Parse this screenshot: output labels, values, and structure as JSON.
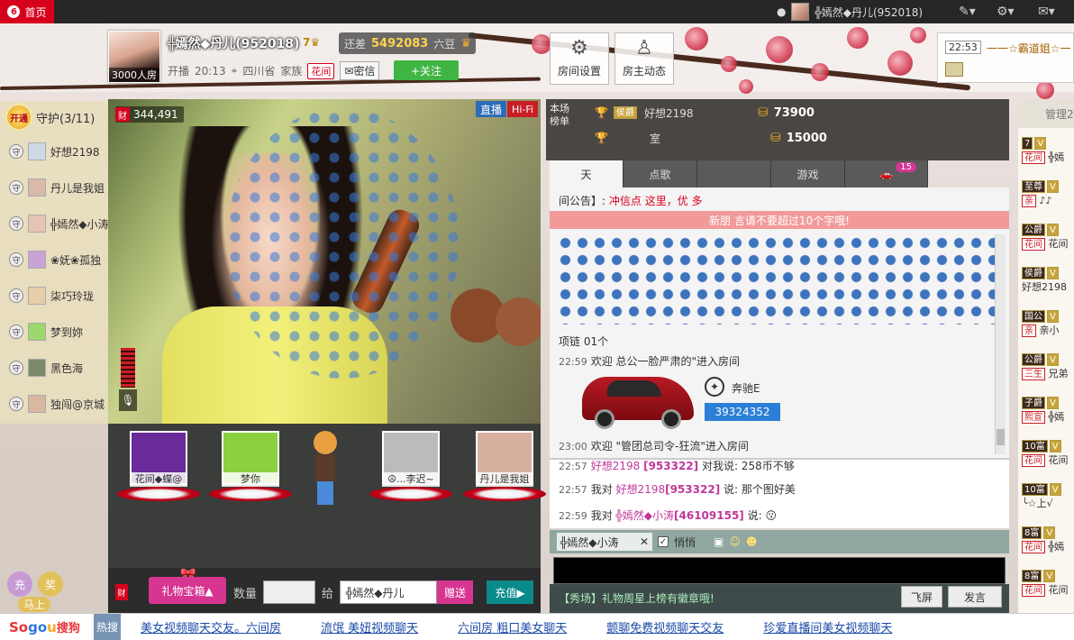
{
  "topbar": {
    "home_label": "首页",
    "user_name": "╬嫣然◆丹儿(952018)"
  },
  "host": {
    "room_count_label": "3000人房",
    "name": "╬嫣然◆丹儿(952018)",
    "level": "7",
    "gap_label": "还差",
    "gap_value": "5492083",
    "gap_unit": "六豆",
    "start_label": "开播",
    "start_time": "20:13",
    "location": "四川省",
    "family_label": "家族",
    "family_tag": "花间",
    "message_label": "密信",
    "follow_label": "+关注"
  },
  "header_buttons": [
    {
      "label": "房间设置",
      "icon": "gear-icon"
    },
    {
      "label": "房主动态",
      "icon": "person-icon"
    }
  ],
  "side_widget": {
    "time": "22:53",
    "text": "一一☆霸道姐☆一"
  },
  "guardians": {
    "open_label": "开通",
    "title": "守护(3/11)",
    "badge": "守",
    "items": [
      {
        "name": "好想2198",
        "color": "#cfd8e6"
      },
      {
        "name": "丹儿是我姐",
        "color": "#d9b9a8"
      },
      {
        "name": "╬嫣然◆小涛",
        "color": "#e8c4b4"
      },
      {
        "name": "❀妩❀孤独",
        "color": "#c9a3d6"
      },
      {
        "name": "柒巧玲珑",
        "color": "#e6cfa8"
      },
      {
        "name": "梦到妳",
        "color": "#9cd86a"
      },
      {
        "name": "黑色海",
        "color": "#7a8a6a"
      },
      {
        "name": "独闯@京城",
        "color": "#d8b8a0"
      }
    ]
  },
  "left_actions": {
    "recharge": "充",
    "reward": "奖",
    "shop": "马上"
  },
  "video": {
    "wealth": "344,491",
    "live_label": "直播",
    "hifi_label": "Hi-Fi"
  },
  "stage_seats": [
    {
      "label": "花间◆蝶@",
      "color": "#6a2a9a"
    },
    {
      "label": "梦你",
      "color": "#8ad040"
    },
    {
      "label": "",
      "color": "#3b3d3b"
    },
    {
      "label": "☮...李迟~",
      "color": "#bbbbbb"
    },
    {
      "label": "丹儿是我姐",
      "color": "#d8b0a0"
    }
  ],
  "gift_bar": {
    "wealth_badge": "财",
    "giftbox_label": "礼物宝箱▲",
    "qty_label": "数量",
    "to_label": "给",
    "recipient": "╬嫣然◆丹儿",
    "send_label": "赠送",
    "recharge_label": "充值▶"
  },
  "ranking": {
    "label": "本场榜单",
    "rows": [
      {
        "badge": "侯爵",
        "name": "好想2198",
        "value": "73900"
      },
      {
        "badge": "",
        "name": "室",
        "value": "15000"
      }
    ]
  },
  "chat_tabs": [
    {
      "label": "天",
      "active": true
    },
    {
      "label": "点歌",
      "active": false
    },
    {
      "label": "",
      "active": false
    },
    {
      "label": "游戏",
      "active": false
    },
    {
      "label": "15",
      "active": false,
      "icon": "car-icon"
    }
  ],
  "chat": {
    "announce_prefix": "间公告】:",
    "announce_text": "冲信点  这里，优  多",
    "red_notice": "新朋  言请不要超过10个字哦!",
    "item_line": "项链    01个",
    "lines": [
      {
        "time": "22:59",
        "text": "欢迎 总公一脸严肃的\"进入房间"
      },
      {
        "time": "23:00",
        "text": "欢迎 \"管团总司令-狂流\"进入房间"
      }
    ],
    "car_name": "奔驰E",
    "car_id": "39324352"
  },
  "private_chat": [
    {
      "time": "22:57",
      "user": "好想2198",
      "id": "953322",
      "text": "对我说: 258币不够"
    },
    {
      "time": "22:57",
      "prefix": "我对",
      "user": "好想2198",
      "id": "953322",
      "text": "说: 那个图好美"
    },
    {
      "time": "22:59",
      "prefix": "我对",
      "user": "╬嫣然◆小涛",
      "id": "46109155",
      "text": "说:"
    }
  ],
  "input": {
    "target": "╬嫣然◆小涛",
    "whisper_label": "悄悄",
    "hint": "【秀场】礼物周星上榜有徽章哦!",
    "fly_label": "飞屏",
    "say_label": "发言"
  },
  "admin": {
    "title": "管理2",
    "rows": [
      {
        "badge": "7",
        "name": "╬嫣",
        "tag": "花间"
      },
      {
        "badge": "至尊",
        "name": "♪♪",
        "tag": "亲"
      },
      {
        "badge": "公爵",
        "name": "花间",
        "tag": "花间"
      },
      {
        "badge": "侯爵",
        "name": "好想2198",
        "tag": ""
      },
      {
        "badge": "国公",
        "name": "亲小",
        "tag": "亲"
      },
      {
        "badge": "公爵",
        "name": "兄弟",
        "tag": "三生"
      },
      {
        "badge": "子爵",
        "name": "╬嫣",
        "tag": "熙宣"
      },
      {
        "badge": "10富",
        "name": "花间",
        "tag": "花间"
      },
      {
        "badge": "10富",
        "name": "╰☆上√",
        "tag": ""
      },
      {
        "badge": "8富",
        "name": "╬嫣",
        "tag": "花间"
      },
      {
        "badge": "8富",
        "name": "花间",
        "tag": "花间"
      }
    ]
  },
  "hotbar": {
    "brand": "Sogou搜狗",
    "hot_label": "热搜",
    "links": [
      "美女视频聊天交友。六间房",
      "流氓 美妞视频聊天",
      "六间房 粗口美女聊天",
      "颤聊免费视频聊天交友",
      "珍爱直播间美女视频聊天"
    ]
  },
  "colors": {
    "brand_red": "#d6001c",
    "follow_green": "#3fb543",
    "gift_pink": "#d73592"
  }
}
